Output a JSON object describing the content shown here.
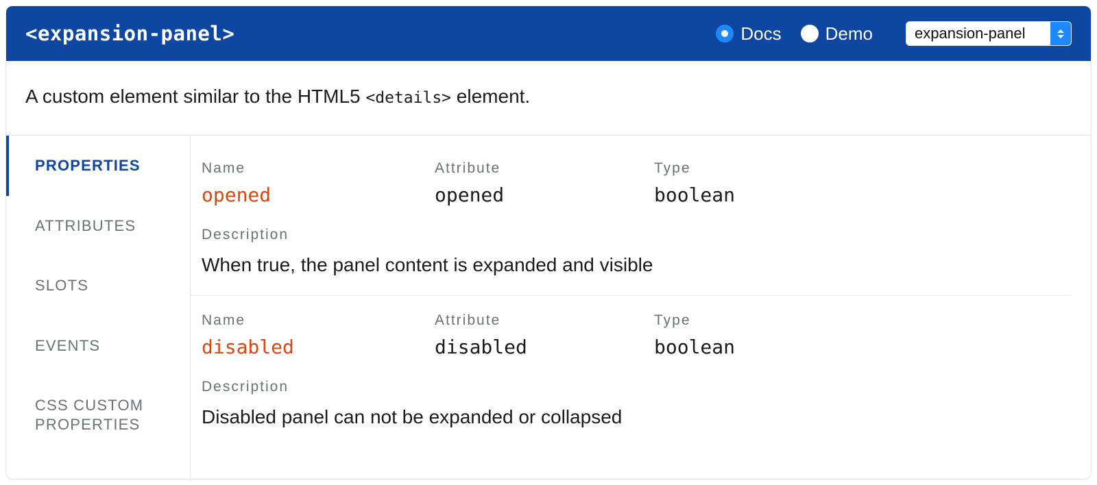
{
  "header": {
    "title": "<expansion-panel>",
    "radios": {
      "docs": "Docs",
      "demo": "Demo"
    },
    "select_value": "expansion-panel"
  },
  "intro": {
    "prefix": "A custom element similar to the HTML5 ",
    "code": "<details>",
    "suffix": " element."
  },
  "columns": {
    "name": "Name",
    "attribute": "Attribute",
    "type": "Type",
    "description": "Description"
  },
  "tabs": {
    "properties": "PROPERTIES",
    "attributes": "ATTRIBUTES",
    "slots": "SLOTS",
    "events": "EVENTS",
    "css": "CSS CUSTOM PROPERTIES"
  },
  "properties": [
    {
      "name": "opened",
      "attribute": "opened",
      "type": "boolean",
      "description": "When true, the panel content is expanded and visible"
    },
    {
      "name": "disabled",
      "attribute": "disabled",
      "type": "boolean",
      "description": "Disabled panel can not be expanded or collapsed"
    }
  ]
}
